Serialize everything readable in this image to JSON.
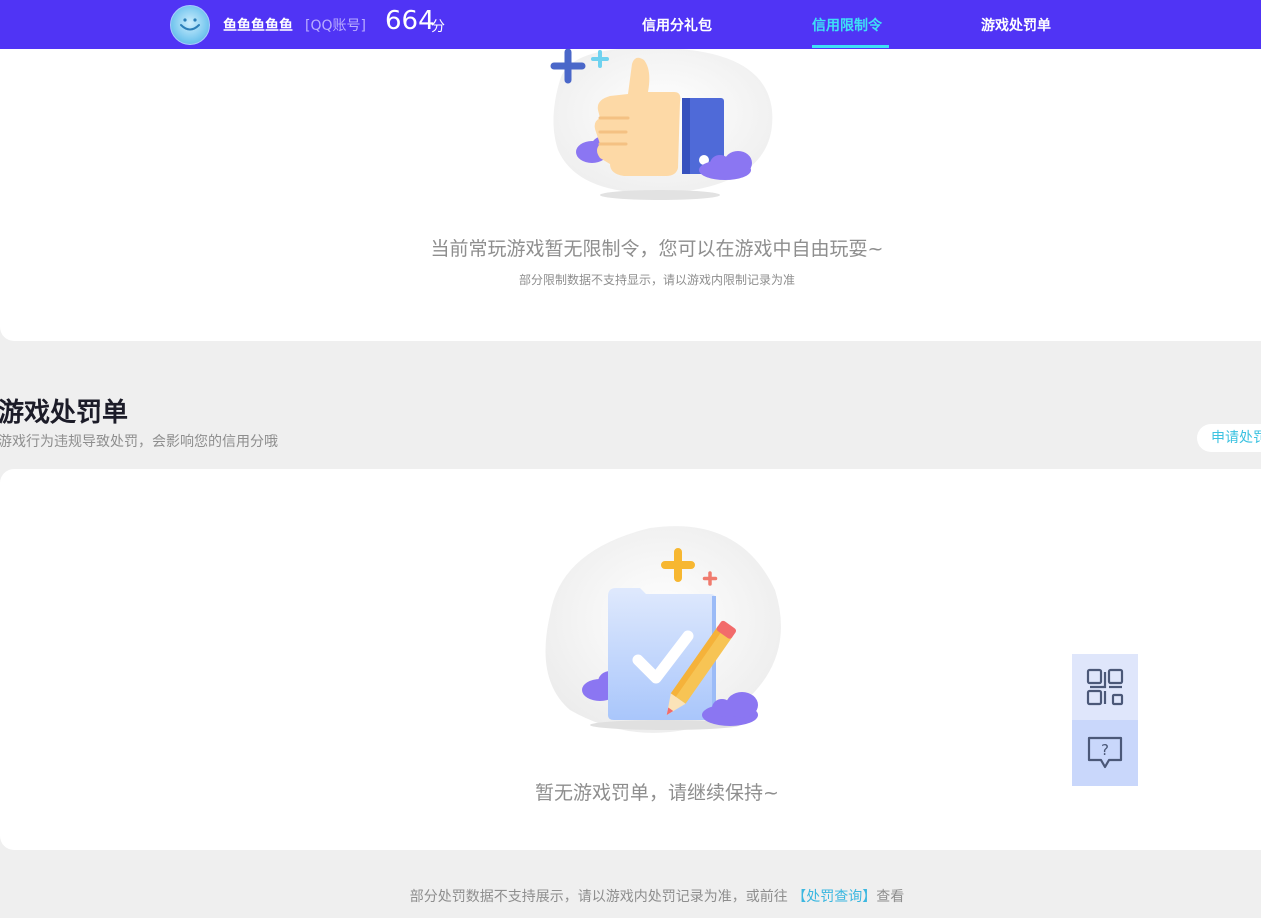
{
  "header": {
    "nickname": "鱼鱼鱼鱼鱼",
    "account_tag": "[QQ账号]",
    "score": "664",
    "score_unit": "分",
    "nav": [
      {
        "label": "信用分礼包",
        "active": false
      },
      {
        "label": "信用限制令",
        "active": true
      },
      {
        "label": "游戏处罚单",
        "active": false
      }
    ]
  },
  "restriction": {
    "empty_title": "当前常玩游戏暂无限制令，您可以在游戏中自由玩耍~",
    "empty_subtitle": "部分限制数据不支持显示，请以游戏内限制记录为准"
  },
  "penalty": {
    "title": "游戏处罚单",
    "subtitle": "游戏行为违规导致处罚，会影响您的信用分哦",
    "appeal_button": "申请处罚",
    "empty_title": "暂无游戏罚单，请继续保持~"
  },
  "footer": {
    "note_prefix": "部分处罚数据不支持展示，请以游戏内处罚记录为准，或前往",
    "note_link": "【处罚查询】",
    "note_suffix": "查看"
  },
  "float_tools": [
    "qr-code-icon",
    "help-chat-icon"
  ],
  "colors": {
    "header_bg": "#5034f5",
    "nav_active": "#3ee0f6",
    "link": "#3bb7e0"
  }
}
